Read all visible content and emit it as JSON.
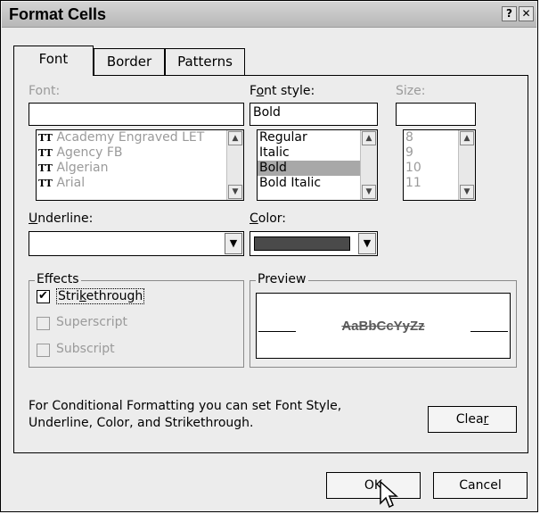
{
  "window": {
    "title": "Format Cells"
  },
  "titlebar": {
    "help_glyph": "?",
    "close_glyph": "✕"
  },
  "tabs": [
    {
      "label": "Font",
      "active": true
    },
    {
      "label": "Border",
      "active": false
    },
    {
      "label": "Patterns",
      "active": false
    }
  ],
  "font": {
    "label": "Font:",
    "value": "",
    "items": [
      "Academy Engraved LET",
      "Agency FB",
      "Algerian",
      "Arial"
    ]
  },
  "font_style": {
    "label_pre": "F",
    "label_u": "o",
    "label_post": "nt style:",
    "value": "Bold",
    "items": [
      "Regular",
      "Italic",
      "Bold",
      "Bold Italic"
    ],
    "selected": "Bold"
  },
  "size": {
    "label": "Size:",
    "value": "",
    "items": [
      "8",
      "9",
      "10",
      "11"
    ]
  },
  "underline": {
    "label_u": "U",
    "label_post": "nderline:",
    "value": ""
  },
  "color": {
    "label_u": "C",
    "label_post": "olor:",
    "swatch": "#4a4a4a"
  },
  "effects": {
    "title": "Effects",
    "strikethrough": {
      "pre": "Stri",
      "u": "k",
      "post": "ethrough",
      "checked": true
    },
    "superscript": {
      "label": "Superscript",
      "checked": false
    },
    "subscript": {
      "label": "Subscript",
      "checked": false
    }
  },
  "preview": {
    "title": "Preview",
    "sample": "AaBbCcYyZz"
  },
  "note": {
    "line1": "For Conditional Formatting you can set Font Style,",
    "line2": "Underline, Color, and Strikethrough."
  },
  "buttons": {
    "clear": {
      "pre": "Clea",
      "u": "r"
    },
    "ok": "OK",
    "cancel": "Cancel"
  },
  "icons": {
    "font_type_icon": "TT",
    "scroll_up": "▲",
    "scroll_down": "▼",
    "dropdown": "▼",
    "check": "✔"
  }
}
